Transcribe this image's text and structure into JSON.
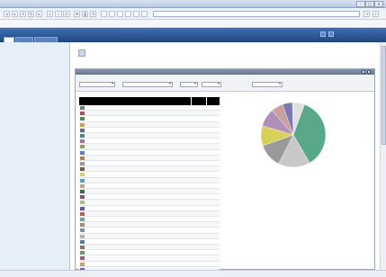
{
  "browser": {
    "title": "",
    "address": "",
    "status_left": "",
    "status_right": "",
    "toolbar_buttons": [
      "",
      "",
      "",
      "",
      "",
      "",
      "",
      "",
      "",
      "",
      "",
      "",
      "",
      "",
      "",
      "",
      "",
      "",
      "",
      ""
    ],
    "links": [
      "",
      "",
      "",
      "",
      "",
      "",
      ""
    ]
  },
  "app": {
    "logo": "",
    "tabs": [
      "",
      "",
      ""
    ]
  },
  "sidebar": {
    "items": [
      "",
      "",
      "",
      "",
      "",
      "",
      "",
      "",
      "",
      "",
      "",
      "",
      "",
      "",
      "",
      "",
      "",
      "",
      "",
      "",
      "",
      "",
      "",
      ""
    ]
  },
  "page": {
    "title": "",
    "description": ""
  },
  "panel": {
    "header": "",
    "filters": [
      {
        "label": "",
        "value": ""
      },
      {
        "label": "",
        "value": ""
      },
      {
        "label": "",
        "value": ""
      },
      {
        "label": "",
        "value": ""
      },
      {
        "label": "",
        "value": ""
      }
    ]
  },
  "table": {
    "columns": [
      "",
      "",
      ""
    ],
    "rows": [
      {
        "name": "",
        "count": "",
        "pct": "",
        "color": "#6c7a8a"
      },
      {
        "name": "",
        "count": "",
        "pct": "",
        "color": "#b04f4f"
      },
      {
        "name": "",
        "count": "",
        "pct": "",
        "color": "#4e8a5c"
      },
      {
        "name": "",
        "count": "",
        "pct": "",
        "color": "#c7a43a"
      },
      {
        "name": "",
        "count": "",
        "pct": "",
        "color": "#6f63a8"
      },
      {
        "name": "",
        "count": "",
        "pct": "",
        "color": "#3f8f95"
      },
      {
        "name": "",
        "count": "",
        "pct": "",
        "color": "#b36da0"
      },
      {
        "name": "",
        "count": "",
        "pct": "",
        "color": "#8fa64a"
      },
      {
        "name": "",
        "count": "",
        "pct": "",
        "color": "#5c7ec2"
      },
      {
        "name": "",
        "count": "",
        "pct": "",
        "color": "#c67c3e"
      },
      {
        "name": "",
        "count": "",
        "pct": "",
        "color": "#9a9a9a"
      },
      {
        "name": "",
        "count": "",
        "pct": "",
        "color": "#7b5b3c"
      },
      {
        "name": "",
        "count": "",
        "pct": "",
        "color": "#d7d15a"
      },
      {
        "name": "",
        "count": "",
        "pct": "",
        "color": "#5aa1c9"
      },
      {
        "name": "",
        "count": "",
        "pct": "",
        "color": "#b8b07a"
      },
      {
        "name": "",
        "count": "",
        "pct": "",
        "color": "#3a6b46"
      },
      {
        "name": "",
        "count": "",
        "pct": "",
        "color": "#8c4e7e"
      },
      {
        "name": "",
        "count": "",
        "pct": "",
        "color": "#a9c56b"
      },
      {
        "name": "",
        "count": "",
        "pct": "",
        "color": "#5e5e9e"
      },
      {
        "name": "",
        "count": "",
        "pct": "",
        "color": "#c25b5b"
      },
      {
        "name": "",
        "count": "",
        "pct": "",
        "color": "#6aa39a"
      },
      {
        "name": "",
        "count": "",
        "pct": "",
        "color": "#a68f5b"
      },
      {
        "name": "",
        "count": "",
        "pct": "",
        "color": "#7a90b8"
      },
      {
        "name": "",
        "count": "",
        "pct": "",
        "color": "#b5b5b5"
      },
      {
        "name": "",
        "count": "",
        "pct": "",
        "color": "#4d7fa0"
      },
      {
        "name": "",
        "count": "",
        "pct": "",
        "color": "#9c6f4b"
      },
      {
        "name": "",
        "count": "",
        "pct": "",
        "color": "#6b9b5e"
      },
      {
        "name": "",
        "count": "",
        "pct": "",
        "color": "#a05a8a"
      },
      {
        "name": "",
        "count": "",
        "pct": "",
        "color": "#c9a45c"
      },
      {
        "name": "",
        "count": "",
        "pct": "",
        "color": "#5b6e8e"
      },
      {
        "name": "",
        "count": "",
        "pct": "",
        "color": "#8aa4c8"
      },
      {
        "name": "",
        "count": "",
        "pct": "",
        "color": "#6e6e6e"
      },
      {
        "name": "",
        "count": "",
        "pct": "",
        "color": "#a3b86a"
      }
    ]
  },
  "chart_data": {
    "type": "pie",
    "title": "",
    "values": [
      36,
      16,
      12,
      10,
      9,
      6,
      5,
      6
    ],
    "colors": [
      "#5aa88a",
      "#c8c8c8",
      "#9a9a9a",
      "#d7d15a",
      "#b08fb8",
      "#c9a0a0",
      "#7a7ab0",
      "#e0e0e0"
    ]
  }
}
